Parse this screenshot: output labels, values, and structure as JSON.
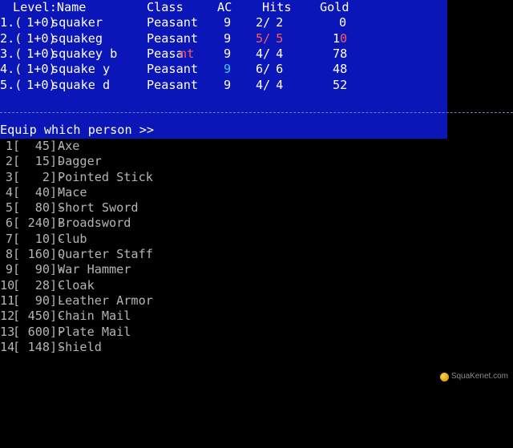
{
  "party": {
    "headers": {
      "level_name": "Level:Name",
      "class": "Class",
      "ac": "AC",
      "hits": "Hits",
      "gold": "Gold"
    },
    "members": [
      {
        "slot": "1.(",
        "level": " 1+0)",
        "name": "squaker",
        "class_a": "Peasant",
        "class_b": "",
        "ac": "9",
        "hits_cur": "2/",
        "hits_max": " 2",
        "gold_a": "0",
        "gold_b": ""
      },
      {
        "slot": "2.(",
        "level": " 1+0)",
        "name": "squakeg",
        "class_a": "Peasant",
        "class_b": "",
        "ac": "9",
        "hits_cur": "5/",
        "hits_max": " 5",
        "gold_a": "1",
        "gold_b": "0"
      },
      {
        "slot": "3.(",
        "level": " 1+0)",
        "name": "squakey b",
        "class_a": "Peasa",
        "class_b": "nt",
        "ac": "9",
        "hits_cur": "4/",
        "hits_max": " 4",
        "gold_a": "78",
        "gold_b": ""
      },
      {
        "slot": "4.(",
        "level": " 1+0)",
        "name": "squake y",
        "class_a": "Peasant",
        "class_b": "",
        "ac": "9",
        "hits_cur": "6/",
        "hits_max": " 6",
        "gold_a": "48",
        "gold_b": ""
      },
      {
        "slot": "5.(",
        "level": " 1+0)",
        "name": "squake d",
        "class_a": "Peasant",
        "class_b": "",
        "ac": "9",
        "hits_cur": "4/",
        "hits_max": " 4",
        "gold_a": "52",
        "gold_b": ""
      }
    ],
    "divider": "--------------------------------------------------------------------------------"
  },
  "prompt": "Equip which person >>",
  "items": [
    {
      "num": "1",
      "price": "45",
      "name": "Axe"
    },
    {
      "num": "2",
      "price": "15",
      "name": "Dagger"
    },
    {
      "num": "3",
      "price": "2",
      "name": "Pointed Stick"
    },
    {
      "num": "4",
      "price": "40",
      "name": "Mace"
    },
    {
      "num": "5",
      "price": "80",
      "name": "Short Sword"
    },
    {
      "num": "6",
      "price": "240",
      "name": "Broadsword"
    },
    {
      "num": "7",
      "price": "10",
      "name": "Club"
    },
    {
      "num": "8",
      "price": "160",
      "name": "Quarter Staff"
    },
    {
      "num": "9",
      "price": "90",
      "name": "War Hammer"
    },
    {
      "num": "10",
      "price": "28",
      "name": "Cloak"
    },
    {
      "num": "11",
      "price": "90",
      "name": "Leather Armor"
    },
    {
      "num": "12",
      "price": "450",
      "name": "Chain Mail"
    },
    {
      "num": "13",
      "price": "600",
      "name": "Plate Mail"
    },
    {
      "num": "14",
      "price": "148",
      "name": "Shield"
    }
  ],
  "item_brackets": {
    "open": "[",
    "close": "]-"
  },
  "watermark": "SquaKenet.com",
  "colors": {
    "panel_bg": "#0a16b8",
    "text": "#ffffff",
    "item_text": "#b4b4b4",
    "highlight_red": "#ff5a5a",
    "highlight_cyan": "#33ccff"
  }
}
